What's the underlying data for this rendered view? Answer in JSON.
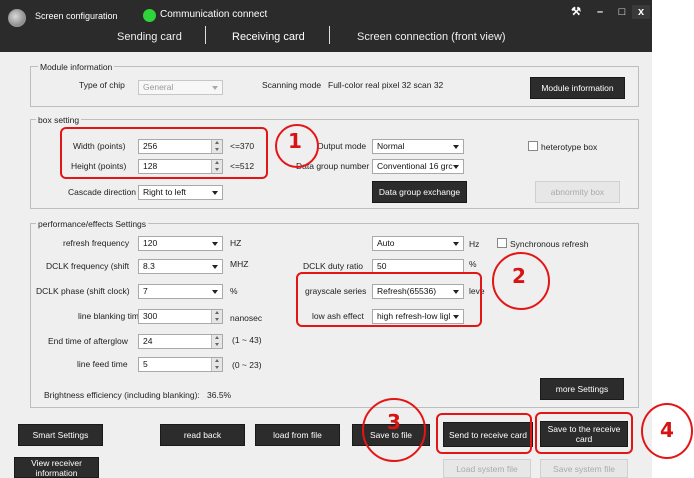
{
  "window": {
    "app_title": "Screen configuration",
    "status": "Communication connect",
    "tabs": [
      "Sending card",
      "Receiving card",
      "Screen connection (front view)"
    ],
    "controls": {
      "settings": "⚒",
      "minimize": "–",
      "maximize": "□",
      "close": "x"
    }
  },
  "module": {
    "title": "Module information",
    "chip_label": "Type of chip",
    "chip_value": "General",
    "scan_label": "Scanning mode",
    "scan_value": "Full-color real pixel 32 scan 32",
    "info_button": "Module information"
  },
  "box": {
    "title": "box setting",
    "width_label": "Width (points)",
    "width_value": "256",
    "width_limit": "<=370",
    "height_label": "Height (points)",
    "height_value": "128",
    "height_limit": "<=512",
    "cascade_label": "Cascade direction",
    "cascade_value": "Right to left",
    "output_label": "Output mode",
    "output_value": "Normal",
    "group_label": "Data group number",
    "group_value": "Conventional 16 grc",
    "exchange_button": "Data group exchange",
    "heterotype_label": "heterotype box",
    "abnormity_button": "abnormity box"
  },
  "performance": {
    "title": "performance/effects Settings",
    "refresh_label": "refresh frequency",
    "refresh_value": "120",
    "refresh_unit": "HZ",
    "auto_value": "Auto",
    "auto_unit": "Hz",
    "sync_label": "Synchronous refresh",
    "dclk_freq_label": "DCLK frequency (shift",
    "dclk_freq_value": "8.3",
    "dclk_freq_unit": "MHZ",
    "duty_label": "DCLK duty ratio",
    "duty_value": "50",
    "duty_unit": "%",
    "dclk_phase_label": "DCLK phase (shift clock)",
    "dclk_phase_value": "7",
    "dclk_phase_unit": "%",
    "gray_label": "grayscale series",
    "gray_value": "Refresh(65536)",
    "gray_unit": "leve",
    "blank_label": "line blanking time",
    "blank_value": "300",
    "blank_unit": "nanosec",
    "ash_label": "low ash effect",
    "ash_value": "high refresh-low ligl",
    "afterglow_label": "End time of afterglow",
    "afterglow_value": "24",
    "afterglow_range": "(1 ~ 43)",
    "feed_label": "line feed time",
    "feed_value": "5",
    "feed_range": "(0 ~ 23)",
    "efficiency_label": "Brightness efficiency (including blanking):",
    "efficiency_value": "36.5%",
    "more_button": "more Settings"
  },
  "actions": {
    "smart": "Smart Settings",
    "read_back": "read back",
    "load_file": "load from file",
    "save_file": "Save to file",
    "send_card": "Send to receive card",
    "save_card": "Save to the receive card",
    "view_receiver": "View receiver information",
    "load_system": "Load system file",
    "save_system": "Save system file"
  },
  "annotations": [
    "1",
    "2",
    "3",
    "4"
  ],
  "colors": {
    "annotation_red": "#e41515",
    "status_green": "#2fd33a",
    "titlebar": "#2b2b2b"
  }
}
